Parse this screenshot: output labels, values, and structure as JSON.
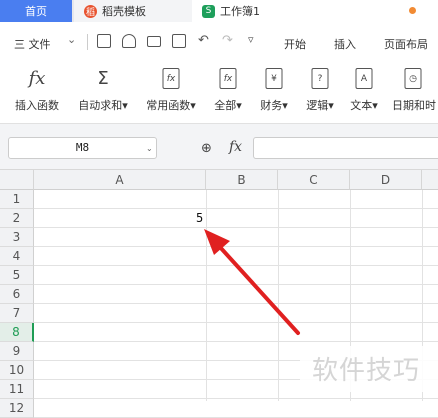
{
  "tabs": {
    "home": "首页",
    "template_icon": "稻",
    "template": "稻壳模板",
    "workbook_icon": "S",
    "workbook": "工作簿1"
  },
  "menu": {
    "file": "三 文件",
    "file_arrow": "⌄",
    "more_arrow": "▿",
    "items": [
      "开始",
      "插入",
      "页面布局"
    ]
  },
  "ribbon": [
    {
      "icon": "fx",
      "label": "插入函数"
    },
    {
      "icon": "Σ",
      "label": "自动求和▾"
    },
    {
      "icon": "fx",
      "label": "常用函数▾"
    },
    {
      "icon": "fx",
      "label": "全部▾"
    },
    {
      "icon": "¥",
      "label": "财务▾"
    },
    {
      "icon": "?",
      "label": "逻辑▾"
    },
    {
      "icon": "A",
      "label": "文本▾"
    },
    {
      "icon": "◷",
      "label": "日期和时"
    }
  ],
  "formula_bar": {
    "name_box": "M8",
    "name_arrow": "⌄",
    "zoom_icon": "⊕",
    "fx_label": "fx",
    "formula": ""
  },
  "sheet": {
    "columns": [
      "A",
      "B",
      "C",
      "D"
    ],
    "rows": [
      "1",
      "2",
      "3",
      "4",
      "5",
      "6",
      "7",
      "8",
      "9",
      "10",
      "11",
      "12"
    ],
    "selected_row": "8",
    "cell_value": "5"
  },
  "watermark": "软件技巧",
  "colors": {
    "accent": "#4a7ef0",
    "sheet_green": "#1f9d55",
    "arrow_red": "#e02020"
  }
}
